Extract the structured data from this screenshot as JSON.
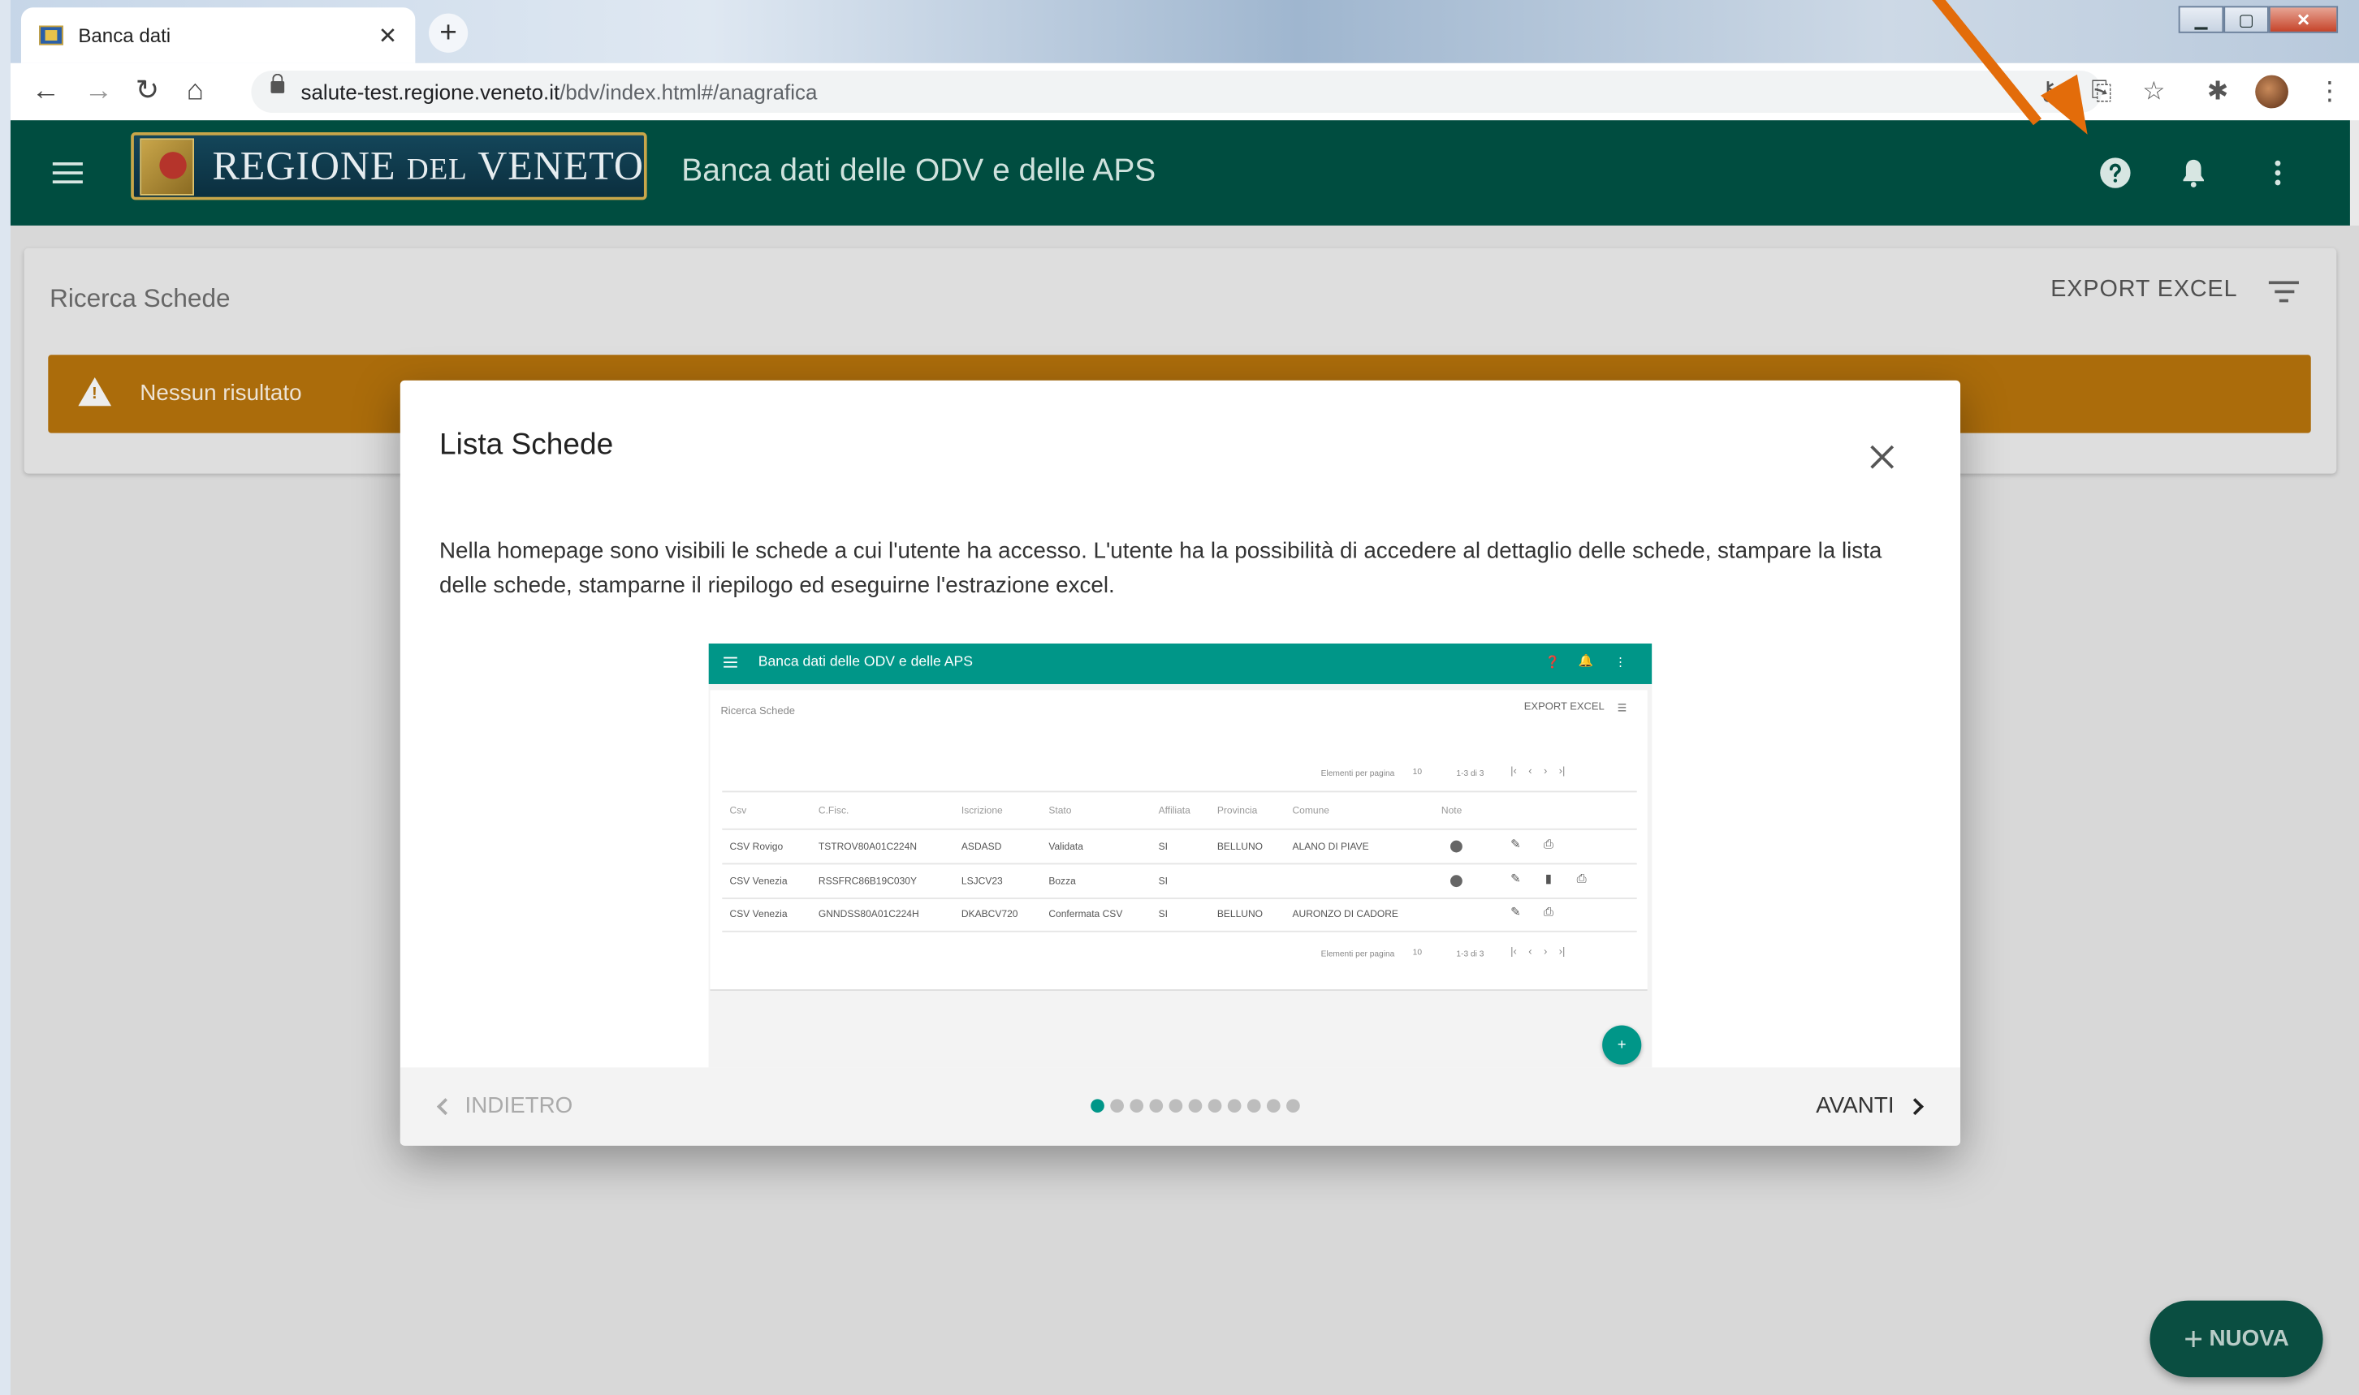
{
  "browser": {
    "tab_title": "Banca dati",
    "url_host": "salute-test.regione.veneto.it",
    "url_path": "/bdv/index.html#/anagrafica"
  },
  "header": {
    "logo_main": "REGIONE ",
    "logo_small": "DEL",
    "logo_end": " VENETO",
    "title": "Banca dati delle ODV e delle APS"
  },
  "page": {
    "title": "Ricerca Schede",
    "export_label": "EXPORT EXCEL",
    "warning_text": "Nessun risultato",
    "fab_label": "NUOVA"
  },
  "dialog": {
    "title": "Lista Schede",
    "body": "Nella homepage sono visibili le schede a cui l'utente ha accesso. L'utente ha la possibilità di accedere al dettaglio delle schede, stampare la lista delle schede, stamparne il riepilogo ed eseguirne l'estrazione excel.",
    "prev_label": "INDIETRO",
    "next_label": "AVANTI",
    "steps_total": 11,
    "step_active": 1
  },
  "preview": {
    "title": "Banca dati delle ODV e delle APS",
    "page_title": "Ricerca Schede",
    "export_label": "EXPORT EXCEL",
    "paginator_label": "Elementi per pagina",
    "paginator_size": "10",
    "paginator_range": "1-3 di 3",
    "columns": [
      "Csv",
      "C.Fisc.",
      "Iscrizione",
      "Stato",
      "Affiliata",
      "Provincia",
      "Comune",
      "Note"
    ],
    "rows": [
      [
        "CSV Rovigo",
        "TSTROV80A01C224N",
        "ASDASD",
        "Validata",
        "SI",
        "BELLUNO",
        "ALANO DI PIAVE"
      ],
      [
        "CSV Venezia",
        "RSSFRC86B19C030Y",
        "LSJCV23",
        "Bozza",
        "SI",
        "",
        ""
      ],
      [
        "CSV Venezia",
        "GNNDSS80A01C224H",
        "DKABCV720",
        "Confermata CSV",
        "SI",
        "BELLUNO",
        "AURONZO DI CADORE"
      ]
    ]
  },
  "colors": {
    "appbar": "#004d40",
    "accent": "#009688",
    "warning": "#b8750c",
    "annotation_arrow": "#e36c0a"
  }
}
